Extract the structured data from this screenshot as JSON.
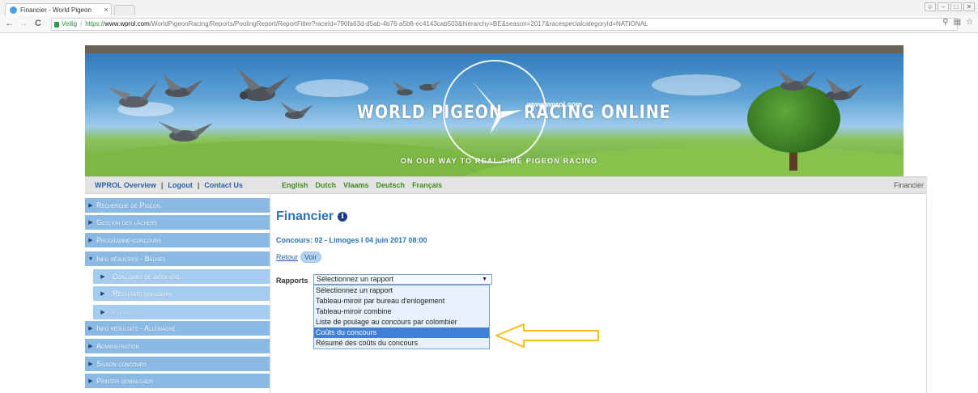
{
  "browser": {
    "tab_title": "Financier - World Pigeon",
    "tab_close": "×",
    "back": "←",
    "forward": "→",
    "reload": "C",
    "secure_label": "Veilig",
    "url_scheme": "https://",
    "url_host": "www.wprol.com",
    "url_rest": "/WorldPigeonRacing/Reports/PoolingReport/ReportFilter?raceId=790fa63d-d5ab-4b76-a5b6-ec4143cab503&hierarchy=BE&season=2017&racespecialcategoryId=NATIONAL"
  },
  "banner": {
    "logo_left": "WORLD PIGEON",
    "logo_right": "RACING ONLINE",
    "logo_url": "www.wprol.com",
    "tagline": "ON OUR WAY TO REAL TIME PIGEON RACING"
  },
  "topnav": {
    "overview": "WPROL Overview",
    "logout": "Logout",
    "contact": "Contact Us",
    "pipe": "|",
    "languages": [
      "English",
      "Dutch",
      "Vlaams",
      "Deutsch",
      "Français"
    ],
    "current_page": "Financier"
  },
  "sidebar": {
    "items": [
      {
        "label": "Recherche de Pigeon",
        "arrow": "▶"
      },
      {
        "label": "Gestion des lâchers",
        "arrow": "▶"
      },
      {
        "label": "Programme-concours",
        "arrow": "▶"
      },
      {
        "label": "Info résultats - Belges",
        "arrow": "▼"
      },
      {
        "label": "Concours de week-end",
        "arrow": "▶"
      },
      {
        "label": "Résultats concours",
        "arrow": "▶"
      },
      {
        "label": "Financier",
        "arrow": "▶"
      },
      {
        "label": "Info résultats - Allemagne",
        "arrow": "▶"
      },
      {
        "label": "Administration",
        "arrow": "▶"
      },
      {
        "label": "Saison concours",
        "arrow": "▶"
      },
      {
        "label": "Printer downloads",
        "arrow": "▶"
      }
    ]
  },
  "main": {
    "title": "Financier",
    "concours": "Concours: 02 - Limoges I 04 juin 2017 08:00",
    "retour": "Retour",
    "voir": "Voir",
    "rapports_label": "Rapports",
    "selected": "Sélectionnez un rapport",
    "options": [
      "Sélectionnez un rapport",
      "Tableau-miroir par bureau d'enlogement",
      "Tableau-miroir combine",
      "Liste de poulage au concours par colombier",
      "Coûts du concours",
      "Résumé des coûts du concours"
    ],
    "highlighted_option": "Coûts du concours"
  },
  "colors": {
    "accent_blue": "#2a73b8",
    "sidebar_blue": "#8ab9e4",
    "language_green": "#3f8d1f",
    "annotation_arrow": "#f2c01e",
    "selected_option": "#3f7fd6"
  }
}
